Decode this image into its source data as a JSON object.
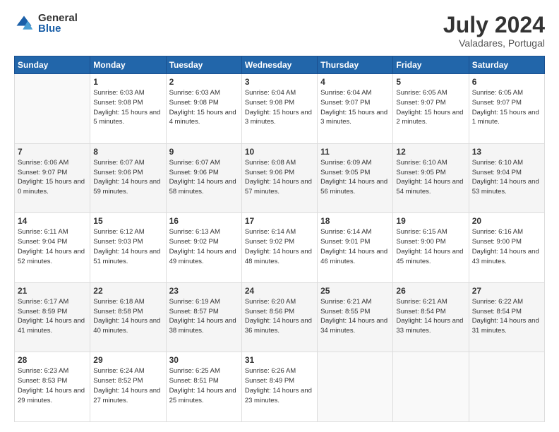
{
  "logo": {
    "general": "General",
    "blue": "Blue"
  },
  "title": "July 2024",
  "subtitle": "Valadares, Portugal",
  "headers": [
    "Sunday",
    "Monday",
    "Tuesday",
    "Wednesday",
    "Thursday",
    "Friday",
    "Saturday"
  ],
  "weeks": [
    [
      {
        "num": "",
        "info": ""
      },
      {
        "num": "1",
        "info": "Sunrise: 6:03 AM\nSunset: 9:08 PM\nDaylight: 15 hours\nand 5 minutes."
      },
      {
        "num": "2",
        "info": "Sunrise: 6:03 AM\nSunset: 9:08 PM\nDaylight: 15 hours\nand 4 minutes."
      },
      {
        "num": "3",
        "info": "Sunrise: 6:04 AM\nSunset: 9:08 PM\nDaylight: 15 hours\nand 3 minutes."
      },
      {
        "num": "4",
        "info": "Sunrise: 6:04 AM\nSunset: 9:07 PM\nDaylight: 15 hours\nand 3 minutes."
      },
      {
        "num": "5",
        "info": "Sunrise: 6:05 AM\nSunset: 9:07 PM\nDaylight: 15 hours\nand 2 minutes."
      },
      {
        "num": "6",
        "info": "Sunrise: 6:05 AM\nSunset: 9:07 PM\nDaylight: 15 hours\nand 1 minute."
      }
    ],
    [
      {
        "num": "7",
        "info": "Sunrise: 6:06 AM\nSunset: 9:07 PM\nDaylight: 15 hours\nand 0 minutes."
      },
      {
        "num": "8",
        "info": "Sunrise: 6:07 AM\nSunset: 9:06 PM\nDaylight: 14 hours\nand 59 minutes."
      },
      {
        "num": "9",
        "info": "Sunrise: 6:07 AM\nSunset: 9:06 PM\nDaylight: 14 hours\nand 58 minutes."
      },
      {
        "num": "10",
        "info": "Sunrise: 6:08 AM\nSunset: 9:06 PM\nDaylight: 14 hours\nand 57 minutes."
      },
      {
        "num": "11",
        "info": "Sunrise: 6:09 AM\nSunset: 9:05 PM\nDaylight: 14 hours\nand 56 minutes."
      },
      {
        "num": "12",
        "info": "Sunrise: 6:10 AM\nSunset: 9:05 PM\nDaylight: 14 hours\nand 54 minutes."
      },
      {
        "num": "13",
        "info": "Sunrise: 6:10 AM\nSunset: 9:04 PM\nDaylight: 14 hours\nand 53 minutes."
      }
    ],
    [
      {
        "num": "14",
        "info": "Sunrise: 6:11 AM\nSunset: 9:04 PM\nDaylight: 14 hours\nand 52 minutes."
      },
      {
        "num": "15",
        "info": "Sunrise: 6:12 AM\nSunset: 9:03 PM\nDaylight: 14 hours\nand 51 minutes."
      },
      {
        "num": "16",
        "info": "Sunrise: 6:13 AM\nSunset: 9:02 PM\nDaylight: 14 hours\nand 49 minutes."
      },
      {
        "num": "17",
        "info": "Sunrise: 6:14 AM\nSunset: 9:02 PM\nDaylight: 14 hours\nand 48 minutes."
      },
      {
        "num": "18",
        "info": "Sunrise: 6:14 AM\nSunset: 9:01 PM\nDaylight: 14 hours\nand 46 minutes."
      },
      {
        "num": "19",
        "info": "Sunrise: 6:15 AM\nSunset: 9:00 PM\nDaylight: 14 hours\nand 45 minutes."
      },
      {
        "num": "20",
        "info": "Sunrise: 6:16 AM\nSunset: 9:00 PM\nDaylight: 14 hours\nand 43 minutes."
      }
    ],
    [
      {
        "num": "21",
        "info": "Sunrise: 6:17 AM\nSunset: 8:59 PM\nDaylight: 14 hours\nand 41 minutes."
      },
      {
        "num": "22",
        "info": "Sunrise: 6:18 AM\nSunset: 8:58 PM\nDaylight: 14 hours\nand 40 minutes."
      },
      {
        "num": "23",
        "info": "Sunrise: 6:19 AM\nSunset: 8:57 PM\nDaylight: 14 hours\nand 38 minutes."
      },
      {
        "num": "24",
        "info": "Sunrise: 6:20 AM\nSunset: 8:56 PM\nDaylight: 14 hours\nand 36 minutes."
      },
      {
        "num": "25",
        "info": "Sunrise: 6:21 AM\nSunset: 8:55 PM\nDaylight: 14 hours\nand 34 minutes."
      },
      {
        "num": "26",
        "info": "Sunrise: 6:21 AM\nSunset: 8:54 PM\nDaylight: 14 hours\nand 33 minutes."
      },
      {
        "num": "27",
        "info": "Sunrise: 6:22 AM\nSunset: 8:54 PM\nDaylight: 14 hours\nand 31 minutes."
      }
    ],
    [
      {
        "num": "28",
        "info": "Sunrise: 6:23 AM\nSunset: 8:53 PM\nDaylight: 14 hours\nand 29 minutes."
      },
      {
        "num": "29",
        "info": "Sunrise: 6:24 AM\nSunset: 8:52 PM\nDaylight: 14 hours\nand 27 minutes."
      },
      {
        "num": "30",
        "info": "Sunrise: 6:25 AM\nSunset: 8:51 PM\nDaylight: 14 hours\nand 25 minutes."
      },
      {
        "num": "31",
        "info": "Sunrise: 6:26 AM\nSunset: 8:49 PM\nDaylight: 14 hours\nand 23 minutes."
      },
      {
        "num": "",
        "info": ""
      },
      {
        "num": "",
        "info": ""
      },
      {
        "num": "",
        "info": ""
      }
    ]
  ]
}
